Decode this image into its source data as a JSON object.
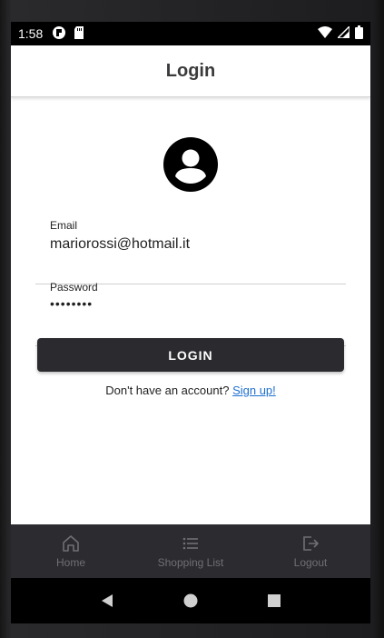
{
  "status_bar": {
    "time": "1:58"
  },
  "app_bar": {
    "title": "Login"
  },
  "form": {
    "email": {
      "label": "Email",
      "value": "mariorossi@hotmail.it"
    },
    "password": {
      "label": "Password",
      "value": "••••••••"
    },
    "login_button": "LOGIN",
    "signup_prompt": "Don't have an account?",
    "signup_link": "Sign up!"
  },
  "bottom_nav": {
    "items": [
      {
        "label": "Home",
        "icon": "home-icon"
      },
      {
        "label": "Shopping List",
        "icon": "list-icon"
      },
      {
        "label": "Logout",
        "icon": "logout-icon"
      }
    ]
  },
  "colors": {
    "button_bg": "#2b2b2f",
    "nav_bg": "#2b2b30",
    "link": "#1e6fd0"
  }
}
